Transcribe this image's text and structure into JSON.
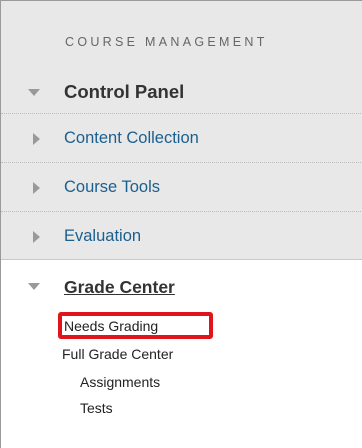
{
  "menu": {
    "heading": "COURSE MANAGEMENT",
    "control_panel": {
      "title": "Control Panel",
      "expanded": true
    },
    "items": [
      {
        "label": "Content Collection",
        "expanded": false
      },
      {
        "label": "Course Tools",
        "expanded": false
      },
      {
        "label": "Evaluation",
        "expanded": false
      }
    ],
    "grade_center": {
      "title": "Grade Center",
      "expanded": true,
      "links": [
        {
          "label": "Needs Grading",
          "highlighted": true
        },
        {
          "label": "Full Grade Center"
        },
        {
          "label": "Assignments"
        },
        {
          "label": "Tests"
        }
      ]
    }
  },
  "colors": {
    "link": "#1b5f8f",
    "highlight": "#e0141c",
    "panel_bg": "#e8e8e8"
  }
}
